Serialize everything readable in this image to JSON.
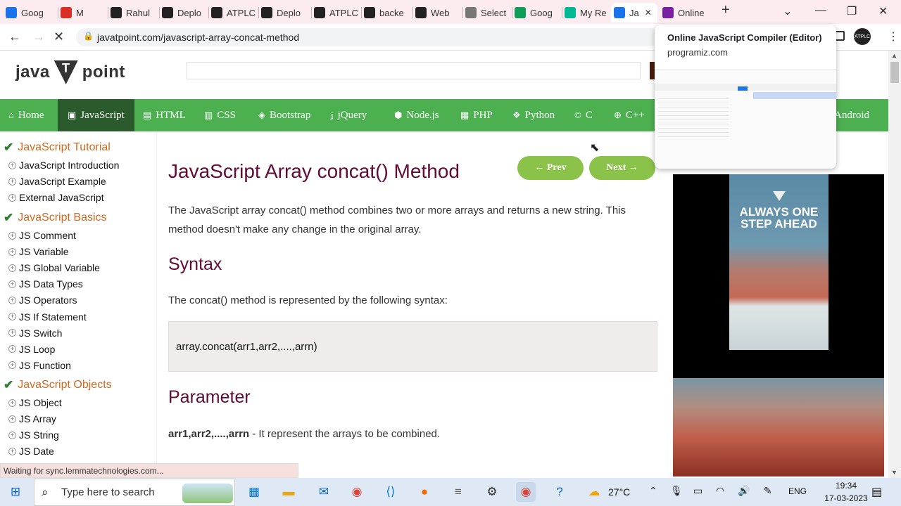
{
  "browser": {
    "tabs": [
      {
        "label": "Goog",
        "icon": "calendar-icon",
        "color": "#1a73e8"
      },
      {
        "label": "M",
        "icon": "gmail-icon",
        "color": "#d93025"
      },
      {
        "label": "Rahul",
        "icon": "github-icon",
        "color": "#222"
      },
      {
        "label": "Deplo",
        "icon": "github-icon",
        "color": "#222"
      },
      {
        "label": "ATPLC",
        "icon": "atplc-icon",
        "color": "#222"
      },
      {
        "label": "Deplo",
        "icon": "github-icon",
        "color": "#222"
      },
      {
        "label": "ATPLC",
        "icon": "atplc-icon",
        "color": "#222"
      },
      {
        "label": "backe",
        "icon": "render-icon",
        "color": "#222"
      },
      {
        "label": "Web",
        "icon": "render-icon",
        "color": "#222"
      },
      {
        "label": "Select",
        "icon": "globe-icon",
        "color": "#777"
      },
      {
        "label": "Goog",
        "icon": "drive-icon",
        "color": "#0f9d58"
      },
      {
        "label": "My Re",
        "icon": "check-icon",
        "color": "#00b894"
      },
      {
        "label": "Ja",
        "icon": "loading-icon",
        "color": "#1a73e8"
      },
      {
        "label": "Online",
        "icon": "programiz-icon",
        "color": "#7b1fa2"
      }
    ],
    "url": "javatpoint.com/javascript-array-concat-method",
    "status": "Waiting for sync.lemmatechnologies.com..."
  },
  "popup": {
    "title": "Online JavaScript Compiler (Editor)",
    "domain": "programiz.com"
  },
  "site": {
    "logo_left": "java",
    "logo_t": "T",
    "logo_right": "point",
    "nav": [
      {
        "label": "Home",
        "icon": "home-icon"
      },
      {
        "label": "JavaScript",
        "icon": "js-icon"
      },
      {
        "label": "HTML",
        "icon": "html5-icon"
      },
      {
        "label": "CSS",
        "icon": "css3-icon"
      },
      {
        "label": "Bootstrap",
        "icon": "bootstrap-icon"
      },
      {
        "label": "jQuery",
        "icon": "jquery-icon"
      },
      {
        "label": "Node.js",
        "icon": "nodejs-icon"
      },
      {
        "label": "PHP",
        "icon": "php-icon"
      },
      {
        "label": "Python",
        "icon": "python-icon"
      },
      {
        "label": "C",
        "icon": "c-icon"
      },
      {
        "label": "C++",
        "icon": "cpp-icon"
      },
      {
        "label": "Android",
        "icon": "android-icon"
      }
    ]
  },
  "sidebar": {
    "head1": "JavaScript Tutorial",
    "group1": [
      "JavaScript Introduction",
      "JavaScript Example",
      "External JavaScript"
    ],
    "head2": "JavaScript Basics",
    "group2": [
      "JS Comment",
      "JS Variable",
      "JS Global Variable",
      "JS Data Types",
      "JS Operators",
      "JS If Statement",
      "JS Switch",
      "JS Loop",
      "JS Function"
    ],
    "head3": "JavaScript Objects",
    "group3": [
      "JS Object",
      "JS Array",
      "JS String",
      "JS Date"
    ]
  },
  "content": {
    "title": "JavaScript Array concat() Method",
    "prev": "← Prev",
    "next": "Next →",
    "intro": "The JavaScript array concat() method combines two or more arrays and returns a new string. This method doesn't make any change in the original array.",
    "syntax_heading": "Syntax",
    "syntax_text": "The concat() method is represented by the following syntax:",
    "code": "array.concat(arr1,arr2,....,arrn)",
    "param_heading": "Parameter",
    "param_name": "arr1,arr2,....,arrn",
    "param_desc": " - It represent the arrays to be combined."
  },
  "ad": {
    "headline": "ALWAYS ONE STEP AHEAD"
  },
  "taskbar": {
    "search_placeholder": "Type here to search",
    "temperature": "27°C",
    "language": "ENG",
    "time": "19:34",
    "date": "17-03-2023"
  }
}
